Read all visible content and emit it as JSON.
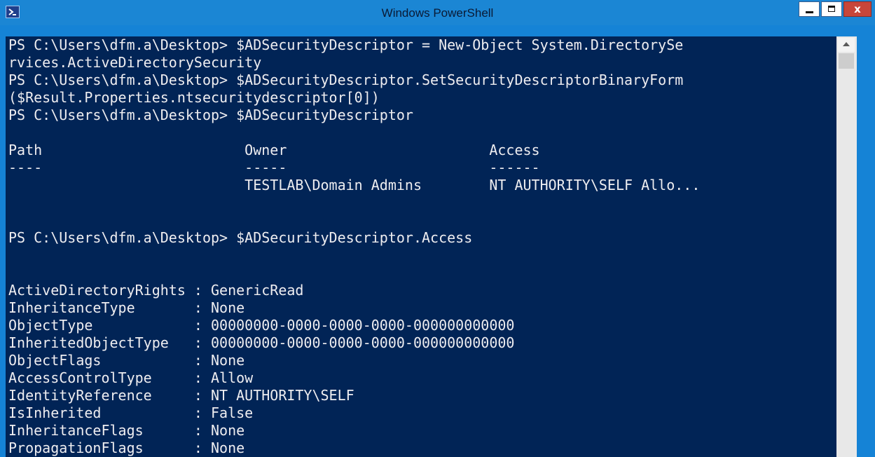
{
  "window": {
    "title": "Windows PowerShell",
    "icon": "powershell-icon",
    "controls": {
      "minimize": "minimize-icon",
      "maximize": "maximize-icon",
      "close_label": "x"
    }
  },
  "colors": {
    "console_background": "#012456",
    "console_text": "#eeedf0",
    "frame": "#1583d6"
  },
  "console": {
    "lines": [
      "PS C:\\Users\\dfm.a\\Desktop> $ADSecurityDescriptor = New-Object System.DirectorySe",
      "rvices.ActiveDirectorySecurity",
      "PS C:\\Users\\dfm.a\\Desktop> $ADSecurityDescriptor.SetSecurityDescriptorBinaryForm",
      "($Result.Properties.ntsecuritydescriptor[0])",
      "PS C:\\Users\\dfm.a\\Desktop> $ADSecurityDescriptor",
      "",
      "Path                        Owner                        Access",
      "----                        -----                        ------",
      "                            TESTLAB\\Domain Admins        NT AUTHORITY\\SELF Allo...",
      "",
      "",
      "PS C:\\Users\\dfm.a\\Desktop> $ADSecurityDescriptor.Access",
      "",
      "",
      "ActiveDirectoryRights : GenericRead",
      "InheritanceType       : None",
      "ObjectType            : 00000000-0000-0000-0000-000000000000",
      "InheritedObjectType   : 00000000-0000-0000-0000-000000000000",
      "ObjectFlags           : None",
      "AccessControlType     : Allow",
      "IdentityReference     : NT AUTHORITY\\SELF",
      "IsInherited           : False",
      "InheritanceFlags      : None",
      "PropagationFlags      : None"
    ]
  }
}
